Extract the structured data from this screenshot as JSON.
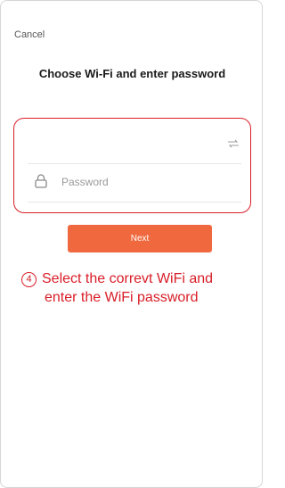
{
  "header": {
    "cancel_label": "Cancel",
    "title": "Choose Wi-Fi and enter password"
  },
  "form": {
    "wifi_value": "",
    "switch_icon": "switch-network-icon",
    "lock_icon": "lock-icon",
    "password_placeholder": "Password",
    "password_value": ""
  },
  "next_label": "Next",
  "annotation": {
    "step_number": "4",
    "text_line1": "Select the correvt WiFi and",
    "text_line2": "enter the WiFi password"
  },
  "colors": {
    "accent": "#f0683d",
    "annotation_red": "#d81e28"
  }
}
